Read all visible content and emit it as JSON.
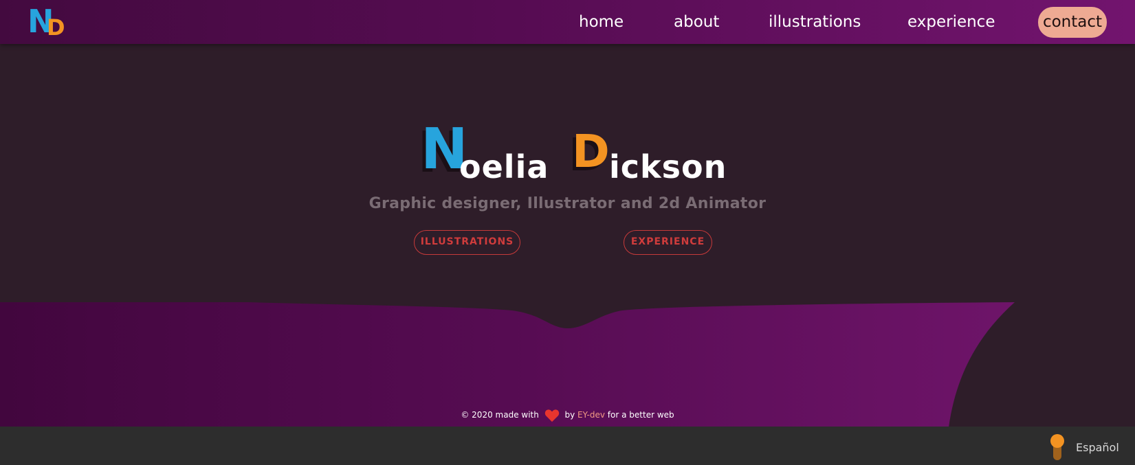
{
  "logo": {
    "n": "N",
    "d": "D"
  },
  "nav": {
    "links": [
      {
        "label": "home"
      },
      {
        "label": "about"
      },
      {
        "label": "illustrations"
      },
      {
        "label": "experience"
      }
    ],
    "contact_label": "contact"
  },
  "hero": {
    "first_initial": "N",
    "first_rest": "oelia",
    "last_initial": "D",
    "last_rest": "ickson",
    "subtitle": "Graphic designer, Illustrator and 2d Animator",
    "buttons": [
      {
        "label": "ILLUSTRATIONS"
      },
      {
        "label": "EXPERIENCE"
      }
    ]
  },
  "footer": {
    "prefix": "© 2020 made with",
    "by": "by",
    "brand": "EY-dev",
    "suffix": "for a better web"
  },
  "language": {
    "label": "Español"
  },
  "colors": {
    "background": "#2e1d29",
    "nav_gradient_start": "#430a3f",
    "nav_gradient_end": "#72146e",
    "accent_blue": "#27a4dd",
    "accent_orange": "#f39322",
    "accent_red": "#d03c3c",
    "contact_pill": "#eeaa93",
    "bottom_bar": "#2d2d2d"
  },
  "icons": {
    "heart": "heart-icon",
    "language_toggle": "toggle-switch-icon"
  }
}
